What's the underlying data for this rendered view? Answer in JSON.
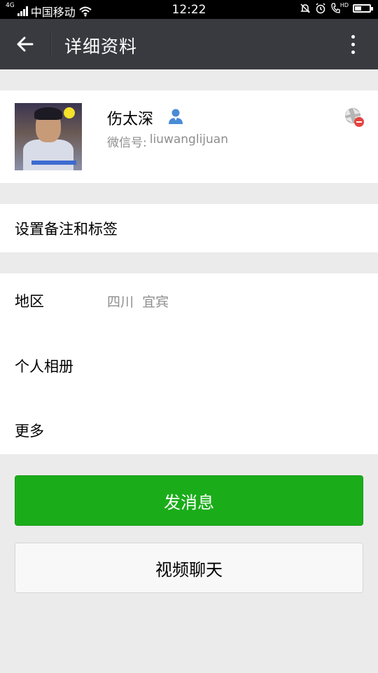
{
  "status_bar": {
    "network_type": "4G",
    "carrier": "中国移动",
    "time": "12:22",
    "hd_label": "HD"
  },
  "header": {
    "title": "详细资料"
  },
  "profile": {
    "name": "伤太深",
    "wechat_id_label": "微信号:",
    "wechat_id": "liuwanglijuan"
  },
  "remark": {
    "label": "设置备注和标签"
  },
  "info": {
    "region_label": "地区",
    "region_value": "四川  宜宾",
    "album_label": "个人相册",
    "more_label": "更多"
  },
  "actions": {
    "send_message": "发消息",
    "video_chat": "视频聊天"
  },
  "colors": {
    "title_bar": "#393a3f",
    "primary_green": "#1aad19",
    "background": "#ebebeb",
    "secondary_text": "#8e8e8e",
    "person_icon": "#4a8bd6"
  }
}
